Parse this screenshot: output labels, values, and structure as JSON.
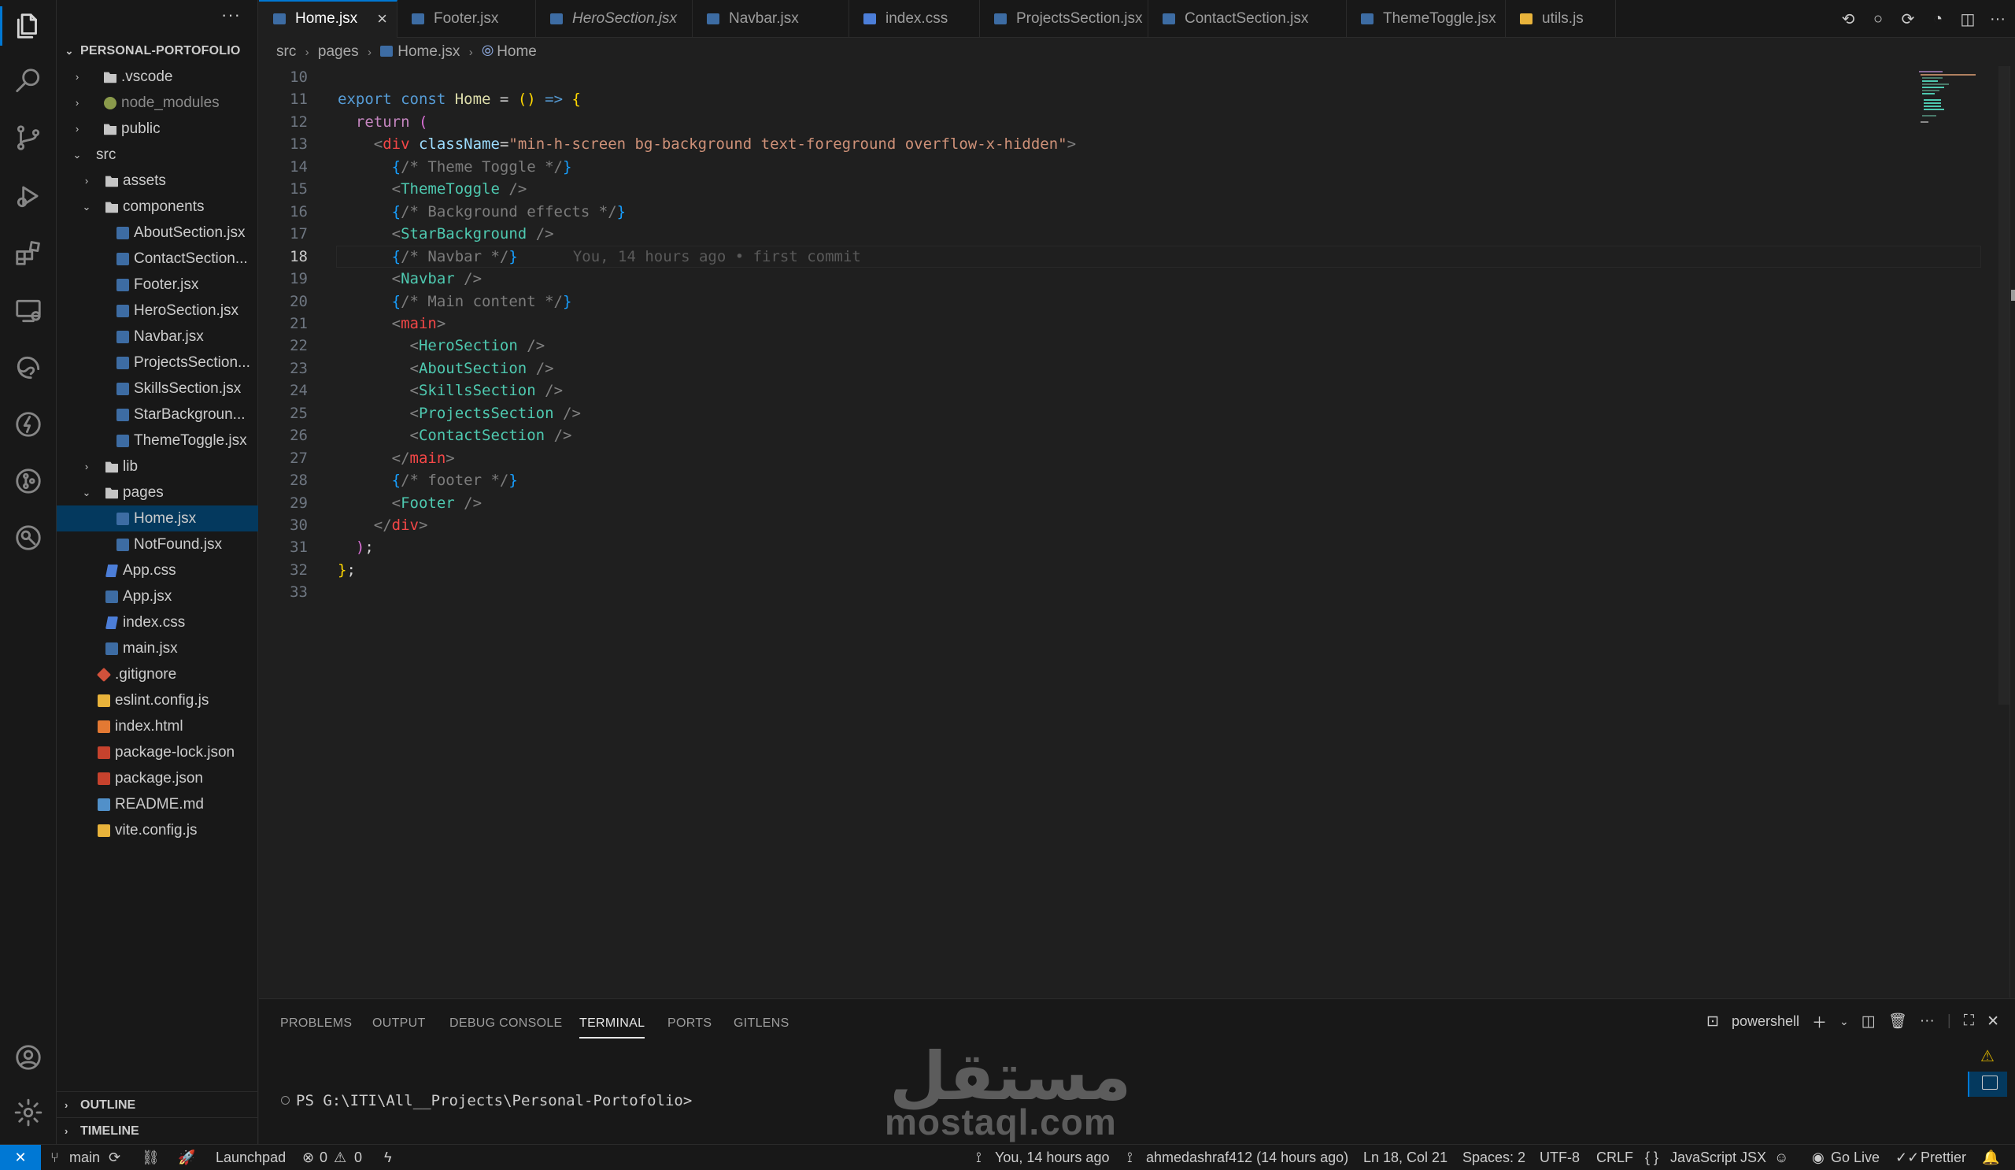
{
  "sidebar": {
    "more": "···",
    "root": "PERSONAL-PORTOFOLIO",
    "tree": [
      {
        "label": ".vscode",
        "kind": "folder",
        "depth": 1,
        "chev": "›"
      },
      {
        "label": "node_modules",
        "kind": "pkg",
        "depth": 1,
        "chev": "›",
        "dim": true
      },
      {
        "label": "public",
        "kind": "folder",
        "depth": 1,
        "chev": "›"
      },
      {
        "label": "src",
        "kind": "none",
        "depth": 1,
        "chev": "⌄"
      },
      {
        "label": "assets",
        "kind": "folder",
        "depth": 2,
        "chev": "›"
      },
      {
        "label": "components",
        "kind": "folder",
        "depth": 2,
        "chev": "⌄"
      },
      {
        "label": "AboutSection.jsx",
        "kind": "jsx",
        "depth": 3
      },
      {
        "label": "ContactSection...",
        "kind": "jsx",
        "depth": 3
      },
      {
        "label": "Footer.jsx",
        "kind": "jsx",
        "depth": 3
      },
      {
        "label": "HeroSection.jsx",
        "kind": "jsx",
        "depth": 3
      },
      {
        "label": "Navbar.jsx",
        "kind": "jsx",
        "depth": 3
      },
      {
        "label": "ProjectsSection...",
        "kind": "jsx",
        "depth": 3
      },
      {
        "label": "SkillsSection.jsx",
        "kind": "jsx",
        "depth": 3
      },
      {
        "label": "StarBackgroun...",
        "kind": "jsx",
        "depth": 3
      },
      {
        "label": "ThemeToggle.jsx",
        "kind": "jsx",
        "depth": 3
      },
      {
        "label": "lib",
        "kind": "folder",
        "depth": 2,
        "chev": "›"
      },
      {
        "label": "pages",
        "kind": "folder",
        "depth": 2,
        "chev": "⌄"
      },
      {
        "label": "Home.jsx",
        "kind": "jsx",
        "depth": 3,
        "selected": true
      },
      {
        "label": "NotFound.jsx",
        "kind": "jsx",
        "depth": 3
      },
      {
        "label": "App.css",
        "kind": "css",
        "depth": 2
      },
      {
        "label": "App.jsx",
        "kind": "jsx",
        "depth": 2
      },
      {
        "label": "index.css",
        "kind": "css",
        "depth": 2
      },
      {
        "label": "main.jsx",
        "kind": "jsx",
        "depth": 2
      },
      {
        "label": ".gitignore",
        "kind": "git",
        "depth": 1
      },
      {
        "label": "eslint.config.js",
        "kind": "js",
        "depth": 1
      },
      {
        "label": "index.html",
        "kind": "html",
        "depth": 1
      },
      {
        "label": "package-lock.json",
        "kind": "json",
        "depth": 1
      },
      {
        "label": "package.json",
        "kind": "json",
        "depth": 1
      },
      {
        "label": "README.md",
        "kind": "md",
        "depth": 1
      },
      {
        "label": "vite.config.js",
        "kind": "js",
        "depth": 1
      }
    ],
    "outline": "OUTLINE",
    "timeline": "TIMELINE"
  },
  "tabs": [
    {
      "label": "Home.jsx",
      "kind": "jsx",
      "active": true,
      "close": "×"
    },
    {
      "label": "Footer.jsx",
      "kind": "jsx"
    },
    {
      "label": "HeroSection.jsx",
      "kind": "jsx",
      "italic": true
    },
    {
      "label": "Navbar.jsx",
      "kind": "jsx"
    },
    {
      "label": "index.css",
      "kind": "css"
    },
    {
      "label": "ProjectsSection.jsx",
      "kind": "jsx"
    },
    {
      "label": "ContactSection.jsx",
      "kind": "jsx"
    },
    {
      "label": "ThemeToggle.jsx",
      "kind": "jsx"
    },
    {
      "label": "utils.js",
      "kind": "js"
    }
  ],
  "tab_actions": [
    "⟲",
    "○",
    "⟳",
    "◔",
    "◫",
    "···"
  ],
  "breadcrumb": {
    "a": "src",
    "b": "pages",
    "c": "Home.jsx",
    "d": "Home"
  },
  "editor": {
    "current_line": 18,
    "blame": "You, 14 hours ago • first commit",
    "lines": [
      {
        "n": "10",
        "tokens": []
      },
      {
        "n": "11",
        "tokens": [
          [
            "kw2",
            "export "
          ],
          [
            "kw2",
            "const "
          ],
          [
            "fn",
            "Home"
          ],
          [
            "wh",
            " = "
          ],
          [
            "br1",
            "() "
          ],
          [
            "kw2",
            "=> "
          ],
          [
            "br1",
            "{"
          ]
        ]
      },
      {
        "n": "12",
        "tokens": [
          [
            "wh",
            "  "
          ],
          [
            "kw",
            "return "
          ],
          [
            "br2",
            "("
          ]
        ]
      },
      {
        "n": "13",
        "tokens": [
          [
            "wh",
            "    "
          ],
          [
            "br",
            "<"
          ],
          [
            "tg",
            "div "
          ],
          [
            "at",
            "className"
          ],
          [
            "wh",
            "="
          ],
          [
            "st",
            "\"min-h-screen bg-background text-foreground overflow-x-hidden\""
          ],
          [
            "br",
            ">"
          ]
        ]
      },
      {
        "n": "14",
        "tokens": [
          [
            "wh",
            "      "
          ],
          [
            "br3",
            "{"
          ],
          [
            "cmg",
            "/* Theme Toggle */"
          ],
          [
            "br3",
            "}"
          ]
        ]
      },
      {
        "n": "15",
        "tokens": [
          [
            "wh",
            "      "
          ],
          [
            "br",
            "<"
          ],
          [
            "tag",
            "ThemeToggle "
          ],
          [
            "br",
            "/>"
          ]
        ]
      },
      {
        "n": "16",
        "tokens": [
          [
            "wh",
            "      "
          ],
          [
            "br3",
            "{"
          ],
          [
            "cmg",
            "/* Background effects */"
          ],
          [
            "br3",
            "}"
          ]
        ]
      },
      {
        "n": "17",
        "tokens": [
          [
            "wh",
            "      "
          ],
          [
            "br",
            "<"
          ],
          [
            "tag",
            "StarBackground "
          ],
          [
            "br",
            "/>"
          ]
        ]
      },
      {
        "n": "18",
        "tokens": [
          [
            "wh",
            "      "
          ],
          [
            "br3",
            "{"
          ],
          [
            "cmg",
            "/* Navbar */"
          ],
          [
            "br3",
            "}"
          ]
        ],
        "blame": true
      },
      {
        "n": "19",
        "tokens": [
          [
            "wh",
            "      "
          ],
          [
            "br",
            "<"
          ],
          [
            "tag",
            "Navbar "
          ],
          [
            "br",
            "/>"
          ]
        ]
      },
      {
        "n": "20",
        "tokens": [
          [
            "wh",
            "      "
          ],
          [
            "br3",
            "{"
          ],
          [
            "cmg",
            "/* Main content */"
          ],
          [
            "br3",
            "}"
          ]
        ]
      },
      {
        "n": "21",
        "tokens": [
          [
            "wh",
            "      "
          ],
          [
            "br",
            "<"
          ],
          [
            "tg",
            "main"
          ],
          [
            "br",
            ">"
          ]
        ]
      },
      {
        "n": "22",
        "tokens": [
          [
            "wh",
            "        "
          ],
          [
            "br",
            "<"
          ],
          [
            "tag",
            "HeroSection "
          ],
          [
            "br",
            "/>"
          ]
        ]
      },
      {
        "n": "23",
        "tokens": [
          [
            "wh",
            "        "
          ],
          [
            "br",
            "<"
          ],
          [
            "tag",
            "AboutSection "
          ],
          [
            "br",
            "/>"
          ]
        ]
      },
      {
        "n": "24",
        "tokens": [
          [
            "wh",
            "        "
          ],
          [
            "br",
            "<"
          ],
          [
            "tag",
            "SkillsSection "
          ],
          [
            "br",
            "/>"
          ]
        ]
      },
      {
        "n": "25",
        "tokens": [
          [
            "wh",
            "        "
          ],
          [
            "br",
            "<"
          ],
          [
            "tag",
            "ProjectsSection "
          ],
          [
            "br",
            "/>"
          ]
        ]
      },
      {
        "n": "26",
        "tokens": [
          [
            "wh",
            "        "
          ],
          [
            "br",
            "<"
          ],
          [
            "tag",
            "ContactSection "
          ],
          [
            "br",
            "/>"
          ]
        ]
      },
      {
        "n": "27",
        "tokens": [
          [
            "wh",
            "      "
          ],
          [
            "br",
            "</"
          ],
          [
            "tg",
            "main"
          ],
          [
            "br",
            ">"
          ]
        ]
      },
      {
        "n": "28",
        "tokens": [
          [
            "wh",
            "      "
          ],
          [
            "br3",
            "{"
          ],
          [
            "cmg",
            "/* footer */"
          ],
          [
            "br3",
            "}"
          ]
        ]
      },
      {
        "n": "29",
        "tokens": [
          [
            "wh",
            "      "
          ],
          [
            "br",
            "<"
          ],
          [
            "tag",
            "Footer "
          ],
          [
            "br",
            "/>"
          ]
        ]
      },
      {
        "n": "30",
        "tokens": [
          [
            "wh",
            "    "
          ],
          [
            "br",
            "</"
          ],
          [
            "tg",
            "div"
          ],
          [
            "br",
            ">"
          ]
        ]
      },
      {
        "n": "31",
        "tokens": [
          [
            "wh",
            "  "
          ],
          [
            "br2",
            ")"
          ],
          [
            "wh",
            ";"
          ]
        ]
      },
      {
        "n": "32",
        "tokens": [
          [
            "br1",
            "}"
          ],
          [
            "wh",
            ";"
          ]
        ]
      },
      {
        "n": "33",
        "tokens": []
      }
    ]
  },
  "panel": {
    "tabs": [
      "PROBLEMS",
      "OUTPUT",
      "DEBUG CONSOLE",
      "TERMINAL",
      "PORTS",
      "GITLENS"
    ],
    "active_tab": "TERMINAL",
    "shell": "powershell",
    "prompt": "PS G:\\ITI\\All__Projects\\Personal-Portofolio>"
  },
  "watermark": {
    "arabic": "مستقل",
    "latin": "mostaql.com"
  },
  "status": {
    "remote": "✕",
    "branch": "main",
    "launchpad": "Launchpad",
    "errors": "0",
    "warnings": "0",
    "blame": "You, 14 hours ago",
    "author": "ahmedashraf412 (14 hours ago)",
    "position": "Ln 18, Col 21",
    "spaces": "Spaces: 2",
    "encoding": "UTF-8",
    "eol": "CRLF",
    "language": "JavaScript JSX",
    "golive": "Go Live",
    "prettier": "Prettier"
  },
  "colors": {
    "accent": "#0078d4",
    "selection": "#04395e"
  }
}
